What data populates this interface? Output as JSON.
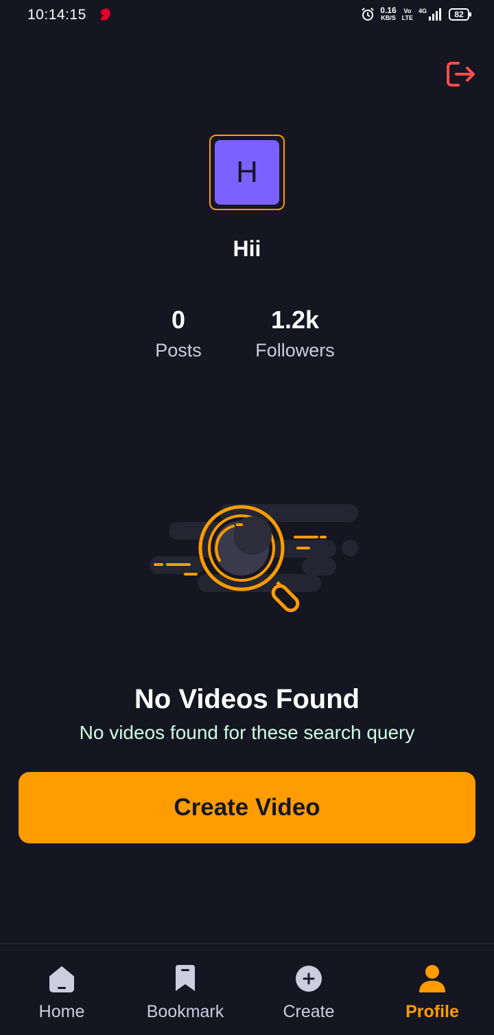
{
  "status_bar": {
    "time": "10:14:15",
    "net_speed_value": "0.16",
    "net_speed_unit": "KB/S",
    "volte_top": "Vo",
    "volte_bottom": "LTE",
    "network_type": "4G",
    "battery": "82"
  },
  "profile": {
    "avatar_initial": "H",
    "username": "Hii",
    "stats": [
      {
        "value": "0",
        "label": "Posts"
      },
      {
        "value": "1.2k",
        "label": "Followers"
      }
    ]
  },
  "empty_state": {
    "title": "No Videos Found",
    "subtitle": "No videos found for these search query",
    "button_label": "Create Video"
  },
  "tab_bar": {
    "tabs": [
      {
        "label": "Home",
        "icon": "home-icon"
      },
      {
        "label": "Bookmark",
        "icon": "bookmark-icon"
      },
      {
        "label": "Create",
        "icon": "plus-circle-icon"
      },
      {
        "label": "Profile",
        "icon": "profile-icon"
      }
    ],
    "active": "Profile"
  },
  "colors": {
    "background": "#161622",
    "accent": "#FF9C01",
    "avatar_bg": "#7B61FF",
    "logout": "#FF4D4D",
    "muted_text": "#CDCDE0"
  }
}
